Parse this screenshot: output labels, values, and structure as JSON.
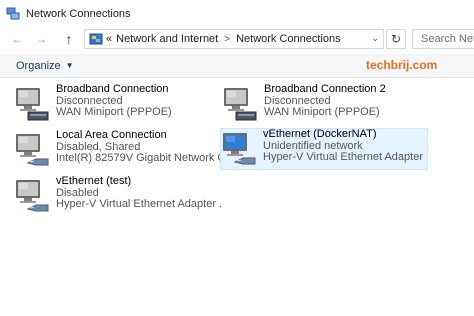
{
  "window": {
    "title": "Network Connections",
    "title_icon": "network-connections-icon"
  },
  "nav": {
    "back_icon": "back-arrow-icon",
    "forward_icon": "forward-arrow-icon",
    "up_icon": "up-arrow-icon"
  },
  "address": {
    "overflow": "«",
    "crumbs": [
      "Network and Internet",
      "Network Connections"
    ],
    "separator": ">",
    "dropdown_icon": "chevron-down-icon",
    "refresh_icon": "refresh-icon"
  },
  "search": {
    "placeholder": "Search Netw"
  },
  "toolbar": {
    "organize_label": "Organize"
  },
  "watermark": "techbrij.com",
  "connections": [
    {
      "name": "Broadband Connection",
      "status": "Disconnected",
      "device": "WAN Miniport (PPPOE)",
      "icon": "computer-disconnected-icon",
      "selected": false
    },
    {
      "name": "Broadband Connection 2",
      "status": "Disconnected",
      "device": "WAN Miniport (PPPOE)",
      "icon": "computer-disconnected-icon",
      "selected": false
    },
    {
      "name": "Local Area Connection",
      "status": "Disabled, Shared",
      "device": "Intel(R) 82579V Gigabit Network C...",
      "icon": "computer-ethernet-icon",
      "selected": false
    },
    {
      "name": "vEthernet (DockerNAT)",
      "status": "Unidentified network",
      "device": "Hyper-V Virtual Ethernet Adapter",
      "icon": "computer-ethernet-active-icon",
      "selected": true
    },
    {
      "name": "vEthernet (test)",
      "status": "Disabled",
      "device": "Hyper-V Virtual Ethernet Adapter ...",
      "icon": "computer-ethernet-icon",
      "selected": false
    }
  ]
}
